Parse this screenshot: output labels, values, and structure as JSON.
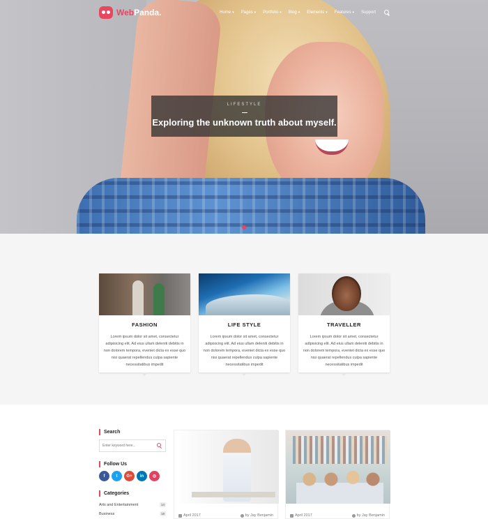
{
  "brand": {
    "name_part1": "Web",
    "name_part2": "Panda."
  },
  "nav": {
    "items": [
      {
        "label": "Home",
        "has_caret": true
      },
      {
        "label": "Pages",
        "has_caret": true
      },
      {
        "label": "Portfolio",
        "has_caret": true
      },
      {
        "label": "Blog",
        "has_caret": true
      },
      {
        "label": "Elements",
        "has_caret": true
      },
      {
        "label": "Features",
        "has_caret": true
      },
      {
        "label": "Support",
        "has_caret": false
      }
    ],
    "search_icon": "search-icon"
  },
  "hero": {
    "category": "LIFESTYLE",
    "title": "Exploring the unknown truth about myself."
  },
  "features": [
    {
      "title": "FASHION",
      "text": "Lorem ipsum dolor sit amet, consectetur adipisicing elit. Ad eius ullam deleniti debitis in non dolorem tempora, eveniet dicta ex esse quo nisi quaerat repellendus culpa sapiente necessitatibus impedit"
    },
    {
      "title": "LIFE STYLE",
      "text": "Lorem ipsum dolor sit amet, consectetur adipisicing elit. Ad eius ullam deleniti debitis in non dolorem tempora, eveniet dicta ex esse quo nisi quaerat repellendus culpa sapiente necessitatibus impedit"
    },
    {
      "title": "TRAVELLER",
      "text": "Lorem ipsum dolor sit amet, consectetur adipisicing elit. Ad eius ullam deleniti debitis in non dolorem tempora, eveniet dicta ex esse quo nisi quaerat repellendus culpa sapiente necessitatibus impedit"
    }
  ],
  "sidebar": {
    "search_title": "Search",
    "search_placeholder": "Enter keyword here...",
    "follow_title": "Follow Us",
    "social": [
      {
        "name": "facebook",
        "glyph": "f",
        "color": "#3b5998"
      },
      {
        "name": "twitter",
        "glyph": "t",
        "color": "#1da1f2"
      },
      {
        "name": "google-plus",
        "glyph": "G+",
        "color": "#dd4b39"
      },
      {
        "name": "linkedin",
        "glyph": "in",
        "color": "#0077b5"
      },
      {
        "name": "instagram",
        "glyph": "◎",
        "color": "#e4405f"
      }
    ],
    "categories_title": "Categories",
    "categories": [
      {
        "name": "Arts and Entertainment",
        "count": "14"
      },
      {
        "name": "Business",
        "count": "18"
      }
    ]
  },
  "posts": [
    {
      "date": "April 2017",
      "author": "by Jay Benjamin"
    },
    {
      "date": "April 2017",
      "author": "by Jay Benjamin"
    }
  ],
  "colors": {
    "accent": "#e8475f"
  }
}
